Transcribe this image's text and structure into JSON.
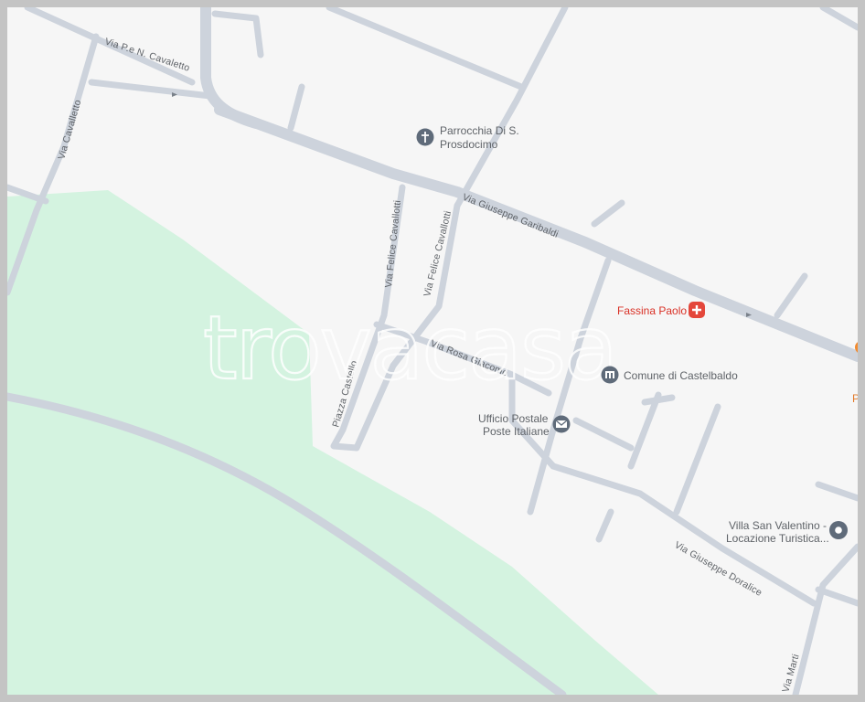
{
  "watermark": "trovacasa",
  "streets": {
    "pn_cavaletto": "Via P.e N. Cavaletto",
    "cavalletto": "Via Cavalletto",
    "garibaldi": "Via Giuseppe Garibaldi",
    "cavallotti_1": "Via Felice Cavallotti",
    "cavallotti_2": "Via Felice Cavallotti",
    "rosa_giacomo": "Via Rosa Giacomo",
    "piazza_castello": "Piazza Castello",
    "doralice": "Via Giuseppe Doralice",
    "marti": "Via Marti"
  },
  "pois": {
    "parrocchia": {
      "line1": "Parrocchia Di S.",
      "line2": "Prosdocimo",
      "icon": "church-icon"
    },
    "fassina": {
      "name": "Fassina Paolo",
      "icon": "medical-icon",
      "color": "#d93025"
    },
    "comune": {
      "name": "Comune di Castelbaldo",
      "icon": "town-hall-icon"
    },
    "ufficio_postale": {
      "line1": "Ufficio Postale",
      "line2": "Poste Italiane",
      "icon": "mail-icon"
    },
    "villa": {
      "line1": "Villa San Valentino -",
      "line2": "Locazione Turistica...",
      "icon": "place-icon"
    }
  },
  "colors": {
    "park": "#d4f3e0",
    "road": "#cdd3dc",
    "background": "#f6f6f6",
    "marker": "#5f6b7a",
    "accent_red": "#d93025"
  }
}
